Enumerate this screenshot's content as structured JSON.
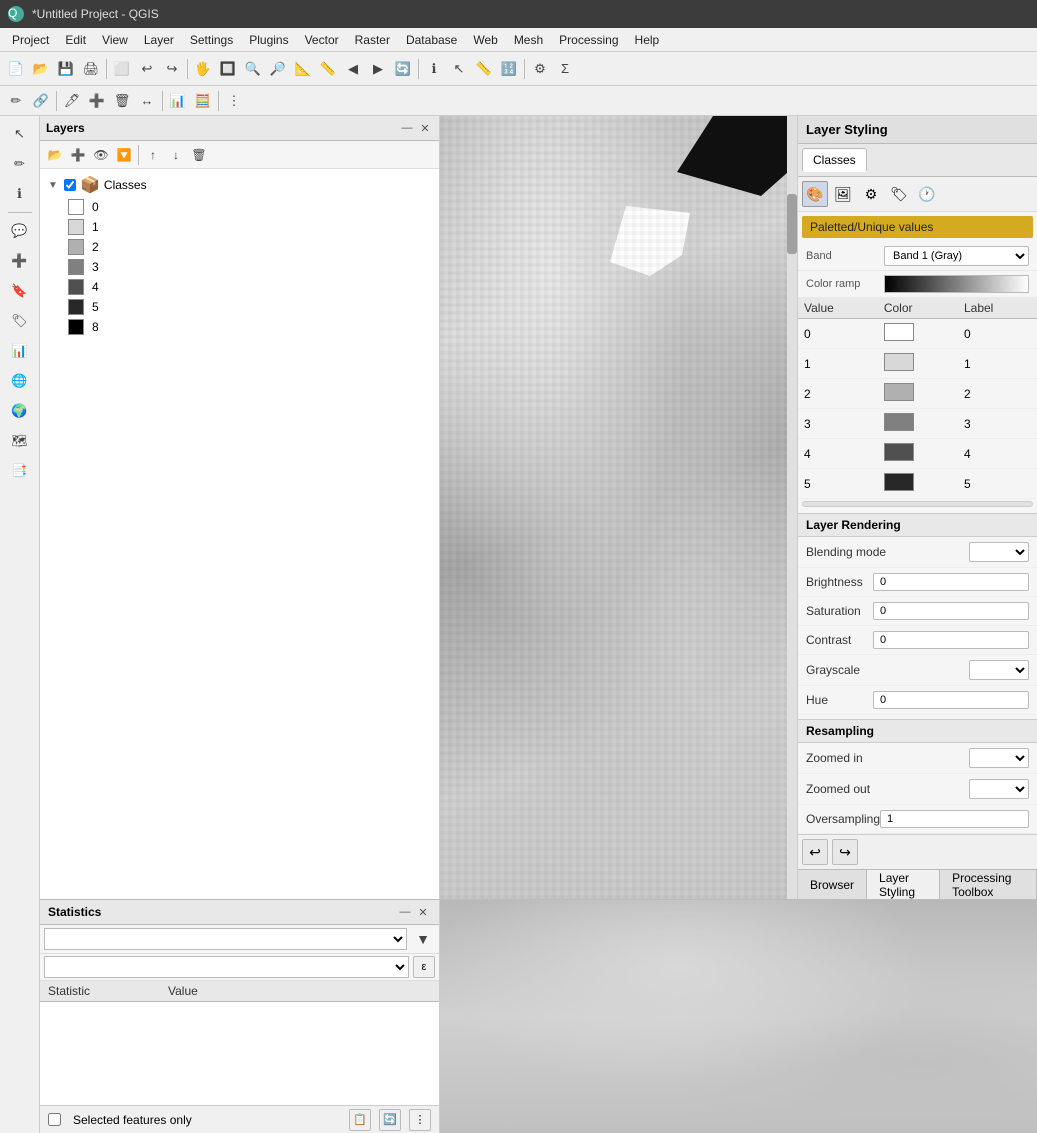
{
  "titleBar": {
    "title": "*Untitled Project - QGIS",
    "icon": "Q"
  },
  "menuBar": {
    "items": [
      "Project",
      "Edit",
      "View",
      "Layer",
      "Settings",
      "Plugins",
      "Vector",
      "Raster",
      "Database",
      "Web",
      "Mesh",
      "Processing",
      "Help"
    ]
  },
  "toolbar1": {
    "buttons": [
      "📄",
      "📂",
      "💾",
      "🖨",
      "↩",
      "⬜",
      "🔧",
      "🖐",
      "🔀",
      "🔍",
      "🔍",
      "🔍",
      "🔍",
      "🔍",
      "🔍",
      "🔍",
      "🔍",
      "🔍",
      "🔄",
      "🎯",
      "🔍",
      "🔍",
      "🔍",
      "🔍",
      "🔍",
      "🔍",
      "⚙",
      "Σ"
    ]
  },
  "layersPanel": {
    "title": "Layers",
    "layers": [
      {
        "name": "Classes",
        "checked": true,
        "classes": [
          {
            "value": "0",
            "color": "#ffffff"
          },
          {
            "value": "1",
            "color": "#d8d8d8"
          },
          {
            "value": "2",
            "color": "#b0b0b0"
          },
          {
            "value": "3",
            "color": "#808080"
          },
          {
            "value": "4",
            "color": "#505050"
          },
          {
            "value": "5",
            "color": "#282828"
          },
          {
            "value": "8",
            "color": "#000000"
          }
        ]
      }
    ]
  },
  "layerStyling": {
    "title": "Layer Styling",
    "tab": "Classes",
    "renderType": "Paletted/Unique values",
    "band": {
      "label": "Band",
      "value": "Band 1 (Gray)"
    },
    "colorRamp": {
      "label": "Color ramp"
    },
    "tableHeaders": [
      "Value",
      "Color",
      "Label"
    ],
    "colorEntries": [
      {
        "value": "0",
        "color": "#000000",
        "label": "0",
        "displayColor": "#ffffff"
      },
      {
        "value": "1",
        "color": "#d8d8d8",
        "label": "1",
        "displayColor": "#d8d8d8"
      },
      {
        "value": "2",
        "color": "#b0b0b0",
        "label": "2",
        "displayColor": "#b0b0b0"
      },
      {
        "value": "3",
        "color": "#808080",
        "label": "3",
        "displayColor": "#808080"
      },
      {
        "value": "4",
        "color": "#505050",
        "label": "4",
        "displayColor": "#505050"
      },
      {
        "value": "5",
        "color": "#282828",
        "label": "5",
        "displayColor": "#282828"
      }
    ],
    "layerRendering": {
      "sectionTitle": "Layer Rendering",
      "properties": [
        {
          "label": "Blending mode",
          "value": ""
        },
        {
          "label": "Brightness",
          "value": ""
        },
        {
          "label": "Saturation",
          "value": ""
        },
        {
          "label": "Contrast",
          "value": ""
        },
        {
          "label": "Grayscale",
          "value": ""
        },
        {
          "label": "Hue",
          "value": ""
        }
      ]
    },
    "resampling": {
      "sectionTitle": "Resampling",
      "properties": [
        {
          "label": "Zoomed in",
          "value": ""
        },
        {
          "label": "Zoomed out",
          "value": ""
        },
        {
          "label": "Oversampling",
          "value": ""
        }
      ]
    },
    "bottomTabs": [
      "Browser",
      "Layer Styling",
      "Processing Toolbox"
    ]
  },
  "statisticsPanel": {
    "title": "Statistics",
    "columns": [
      {
        "label": "Statistic"
      },
      {
        "label": "Value"
      }
    ],
    "selectedFeaturesOnly": "Selected features only"
  }
}
